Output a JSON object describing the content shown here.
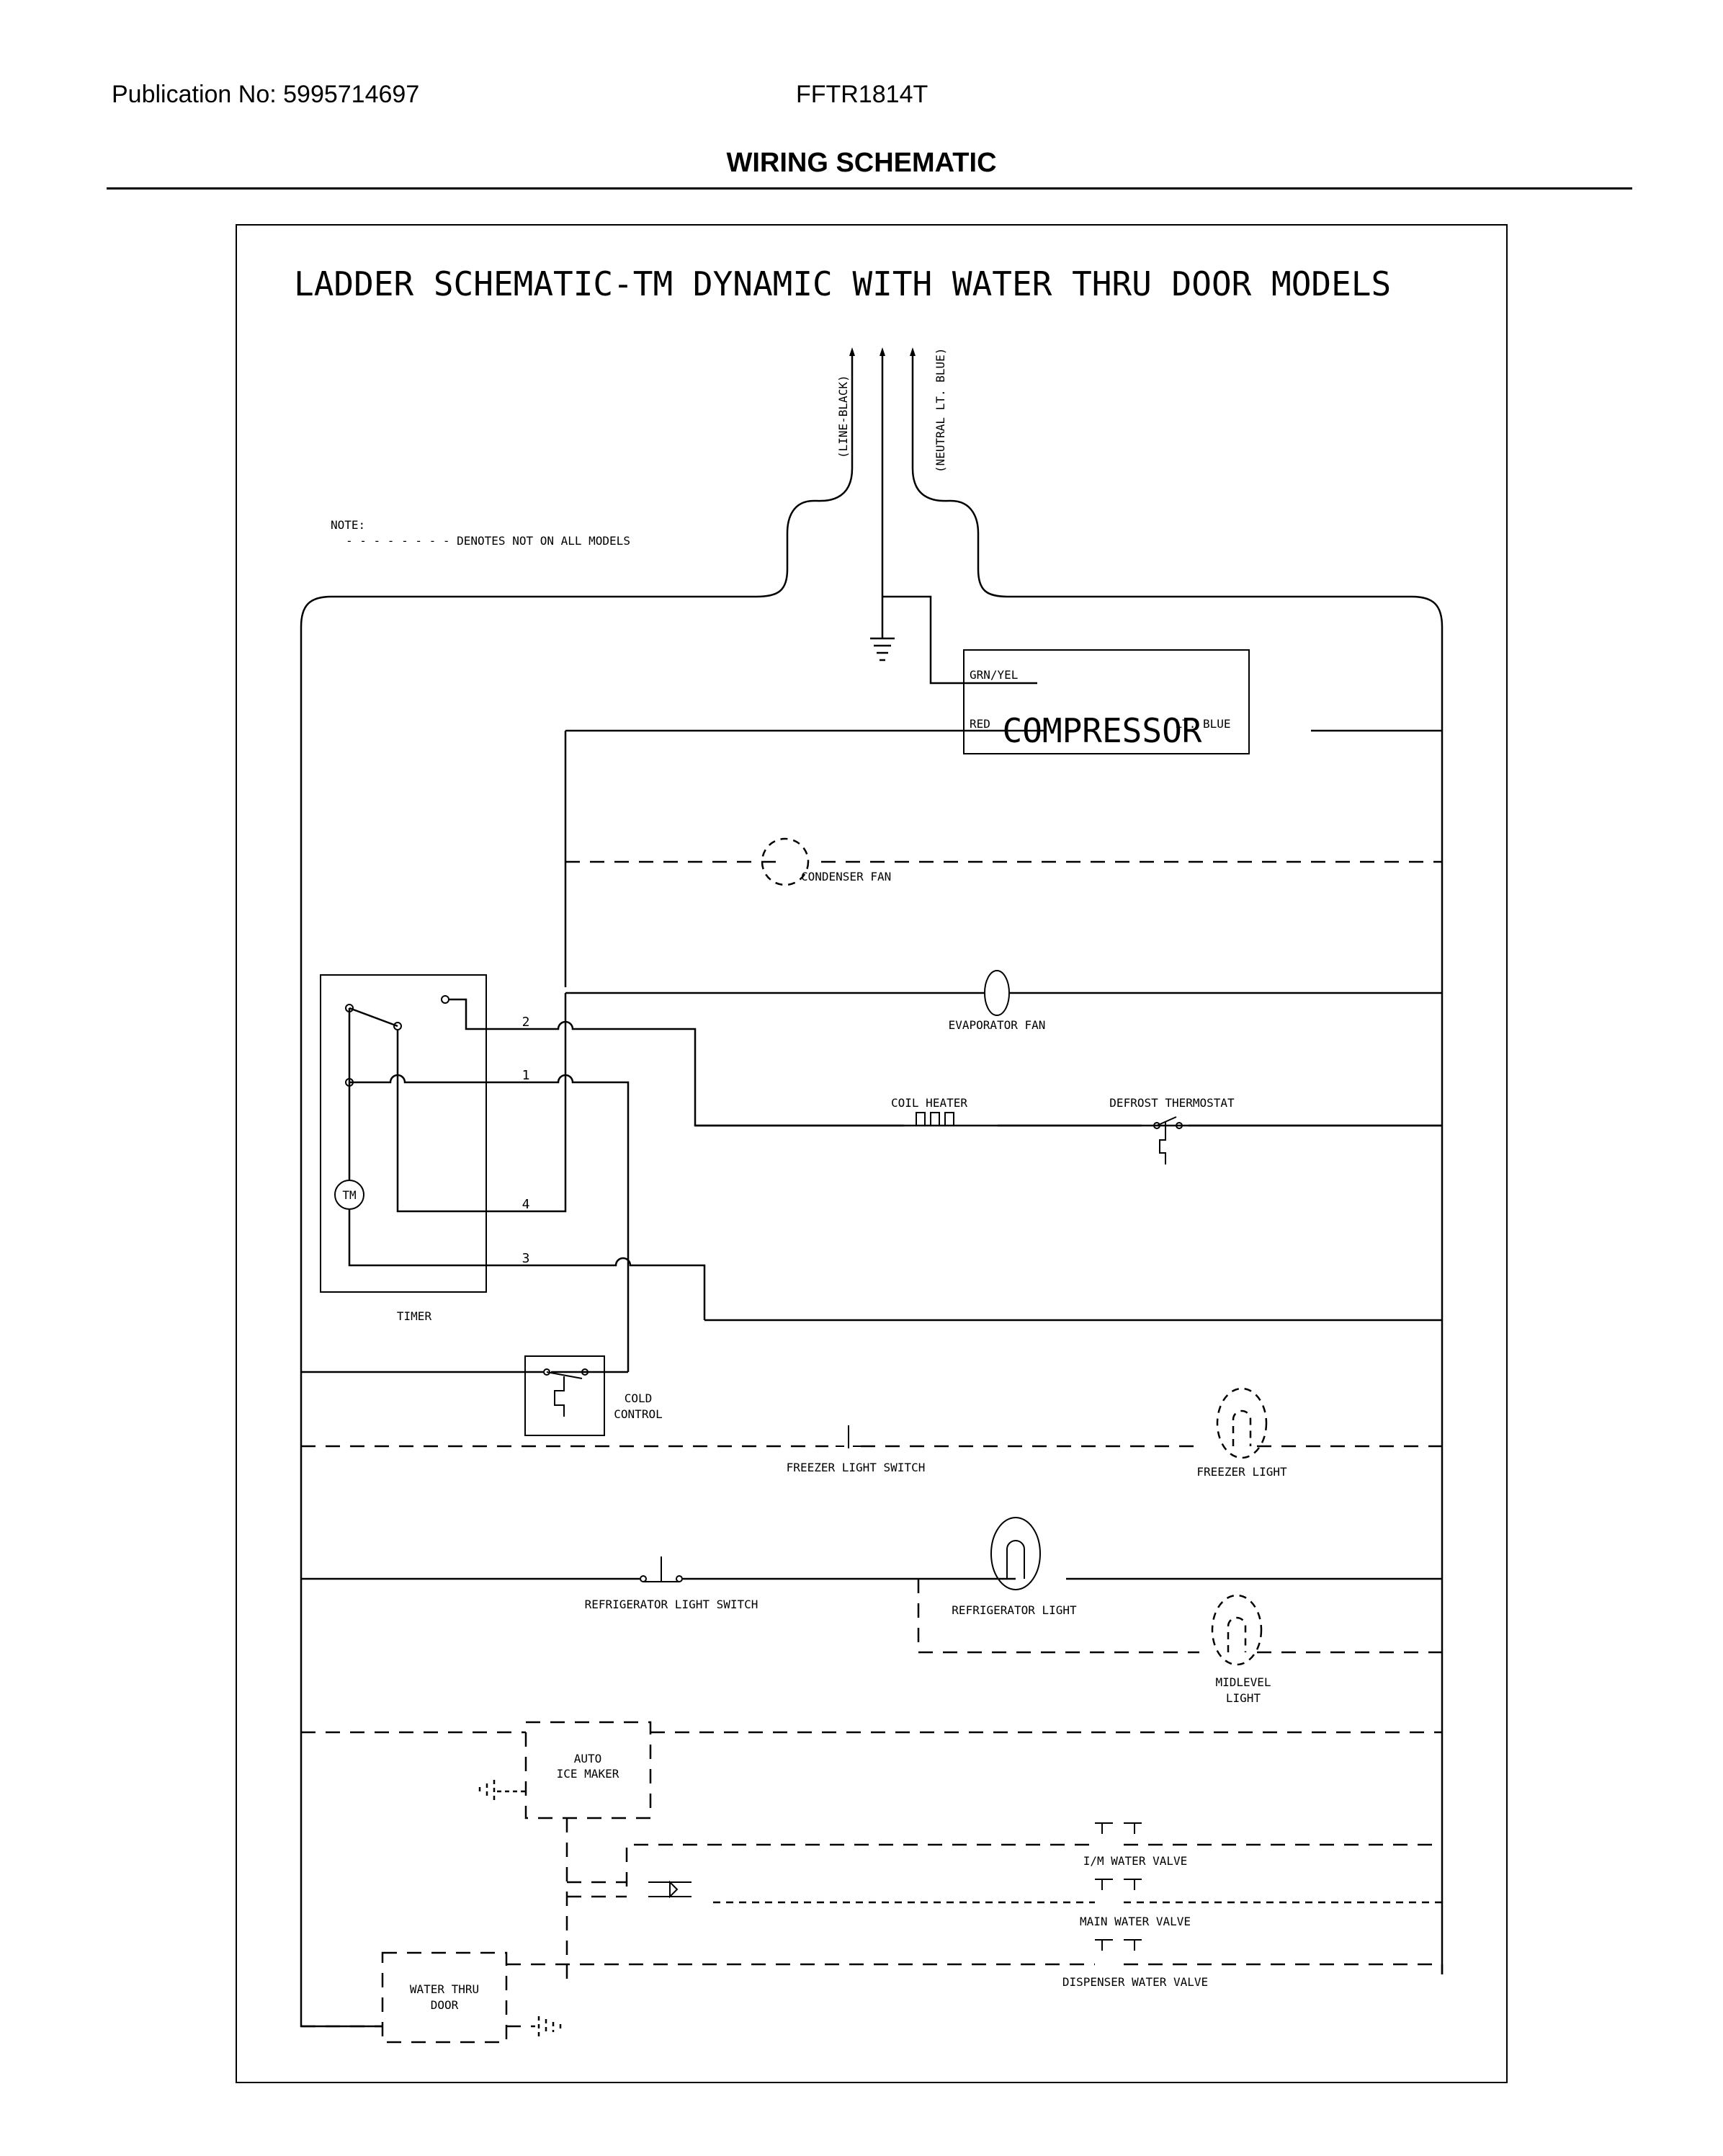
{
  "header": {
    "publication": "Publication No: 5995714697",
    "model": "FFTR1814T",
    "title": "WIRING SCHEMATIC"
  },
  "diagram": {
    "heading": "LADDER SCHEMATIC-TM DYNAMIC WITH WATER THRU DOOR MODELS",
    "supply": {
      "line": "(LINE-BLACK)",
      "neutral": "(NEUTRAL LT. BLUE)"
    },
    "note": {
      "title": "NOTE:",
      "text": "- - - - - - - - DENOTES NOT ON ALL MODELS"
    },
    "compressor": {
      "label": "COMPRESSOR",
      "terminals": {
        "ground": "GRN/YEL",
        "left": "RED",
        "right": "LT. BLUE"
      }
    },
    "components": {
      "condenser_fan": "CONDENSER FAN",
      "evaporator_fan": "EVAPORATOR FAN",
      "coil_heater": "COIL HEATER",
      "defrost_thermostat": "DEFROST THERMOSTAT",
      "timer": "TIMER",
      "timer_motor": "TM",
      "cold_control": [
        "COLD",
        "CONTROL"
      ],
      "freezer_light_switch": "FREEZER LIGHT SWITCH",
      "freezer_light": "FREEZER LIGHT",
      "refrigerator_light_switch": "REFRIGERATOR LIGHT SWITCH",
      "refrigerator_light": "REFRIGERATOR LIGHT",
      "midlevel_light": [
        "MIDLEVEL",
        "LIGHT"
      ],
      "auto_ice_maker": [
        "AUTO",
        "ICE MAKER"
      ],
      "im_water_valve": "I/M WATER VALVE",
      "main_water_valve": "MAIN WATER VALVE",
      "dispenser_water_valve": "DISPENSER WATER VALVE",
      "water_thru_door": [
        "WATER THRU",
        "DOOR"
      ]
    },
    "timer_terminals": [
      "2",
      "1",
      "4",
      "3"
    ]
  }
}
